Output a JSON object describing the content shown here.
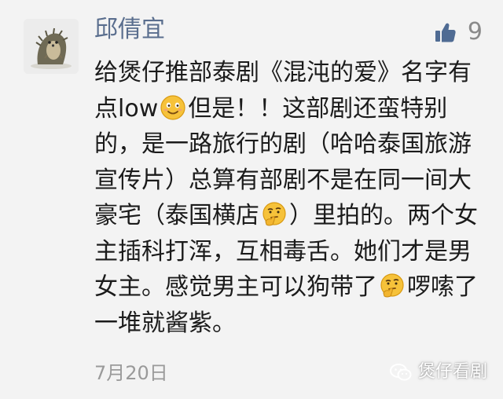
{
  "comment": {
    "username": "邱倩宜",
    "likes": "9",
    "text_parts": [
      "给煲仔推部泰剧《混沌的爱》名字有点low",
      "但是！！这部剧还蛮特别的，是一路旅行的剧（哈哈泰国旅游宣传片）总算有部剧不是在同一间大豪宅（泰国横店",
      "）里拍的。两个女主插科打浑，互相毒舌。她们才是男女主。感觉男主可以狗带了",
      "啰嗦了一堆就酱紫。"
    ],
    "date": "7月20日"
  },
  "icons": {
    "avatar": "hedgehog-avatar-icon",
    "like": "thumbs-up-icon",
    "emoji_smile": "smile-emoji-icon",
    "emoji_think": "thinking-emoji-icon",
    "watermark_logo": "wechat-icon"
  },
  "colors": {
    "username": "#5a6e8e",
    "like_icon": "#4f6b93",
    "text": "#1b1b1b",
    "meta": "#9a9a9a",
    "background": "#f3f3f3"
  },
  "watermark": {
    "label": "煲仔看剧"
  }
}
